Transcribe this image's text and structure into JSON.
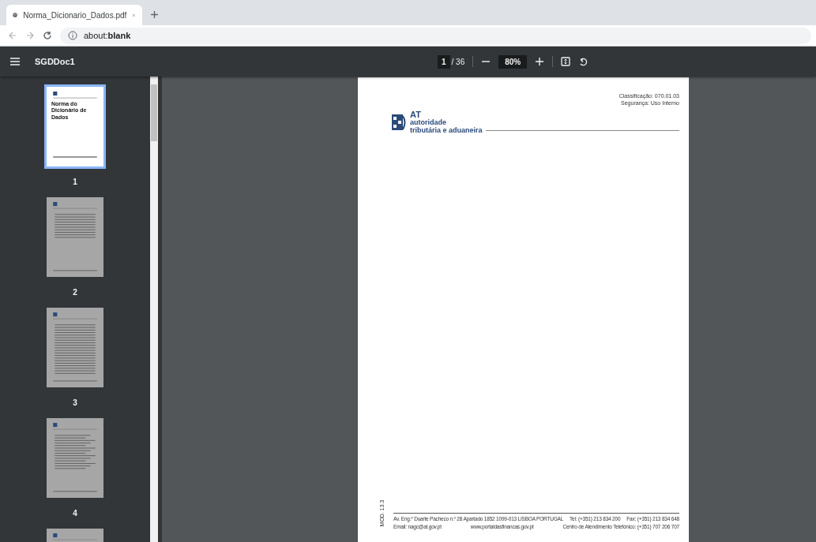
{
  "browser": {
    "tab_title": "Norma_Dicionario_Dados.pdf",
    "address": "about:**blank**"
  },
  "toolbar": {
    "title": "SGDDoc1",
    "page": "1",
    "page_total": "/ 36",
    "zoom": "80%"
  },
  "thumbnails": [
    {
      "label": "1",
      "selected": true,
      "kind": "cover",
      "heading": "Norma do Dicionário de Dados"
    },
    {
      "label": "2",
      "selected": false,
      "kind": "table"
    },
    {
      "label": "3",
      "selected": false,
      "kind": "contents"
    },
    {
      "label": "4",
      "selected": false,
      "kind": "text"
    },
    {
      "selected": false,
      "kind": "text"
    }
  ],
  "page": {
    "classification": [
      "Classificação: 070.01.03",
      "Segurança: Uso Interno"
    ],
    "logo": [
      "AT",
      "autoridade",
      "tributária e aduaneira"
    ],
    "side_code": "MOD. 13.3",
    "footer": [
      [
        "Av. Eng.º Duarte Pacheco n.º 28 Apartado 1852 1099-013 LISBOA PORTUGAL",
        "Tel: (+351) 213 834 200",
        "Fax: (+351) 213 834 648"
      ],
      [
        "Email: nagc@at.gov.pt",
        "www.portaldasfinancas.gov.pt",
        "Centro de Atendimento Telefónico: (+351) 707 206 707"
      ]
    ]
  }
}
